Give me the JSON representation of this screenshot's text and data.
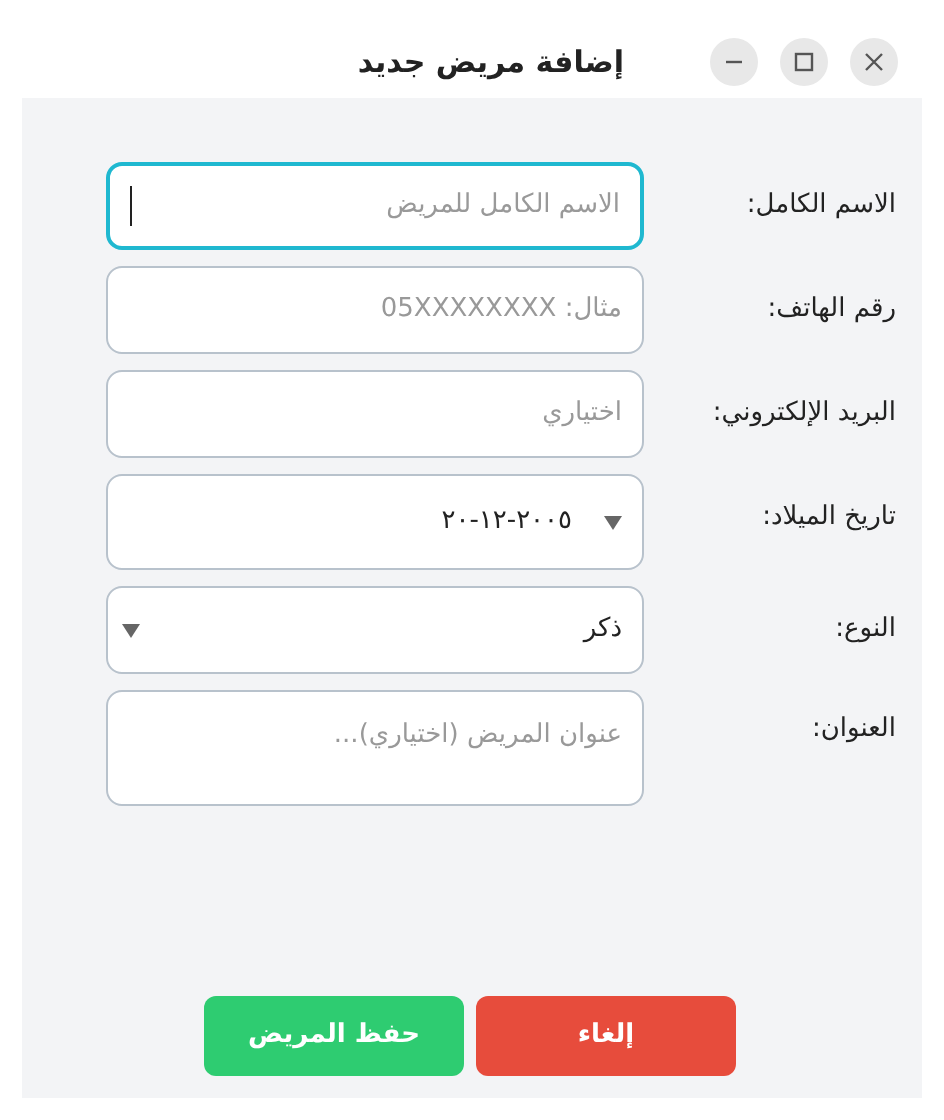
{
  "window": {
    "title": "إضافة مريض جديد",
    "controls": [
      {
        "kind": "close"
      },
      {
        "kind": "maximize"
      },
      {
        "kind": "minimize"
      }
    ]
  },
  "fields": [
    {
      "kind": "text",
      "label": "الاسم الكامل:",
      "placeholder": "الاسم الكامل للمريض",
      "focused": true
    },
    {
      "kind": "text",
      "label": "رقم الهاتف:",
      "placeholder": "مثال: 05XXXXXXXX",
      "focused": false
    },
    {
      "kind": "text",
      "label": "البريد الإلكتروني:",
      "placeholder": "اختياري",
      "focused": false
    },
    {
      "kind": "date",
      "label": "تاريخ الميلاد:",
      "value": "٢٠٠٥-١٢-٢٠",
      "focused": false
    },
    {
      "kind": "select",
      "label": "النوع:",
      "value": "ذكر",
      "focused": false
    },
    {
      "kind": "textarea",
      "label": "العنوان:",
      "placeholder": "عنوان المريض (اختياري)...",
      "focused": false
    }
  ],
  "buttons": [
    {
      "kind": "cancel",
      "label": "إلغاء"
    },
    {
      "kind": "save",
      "label": "حفظ المريض"
    }
  ]
}
